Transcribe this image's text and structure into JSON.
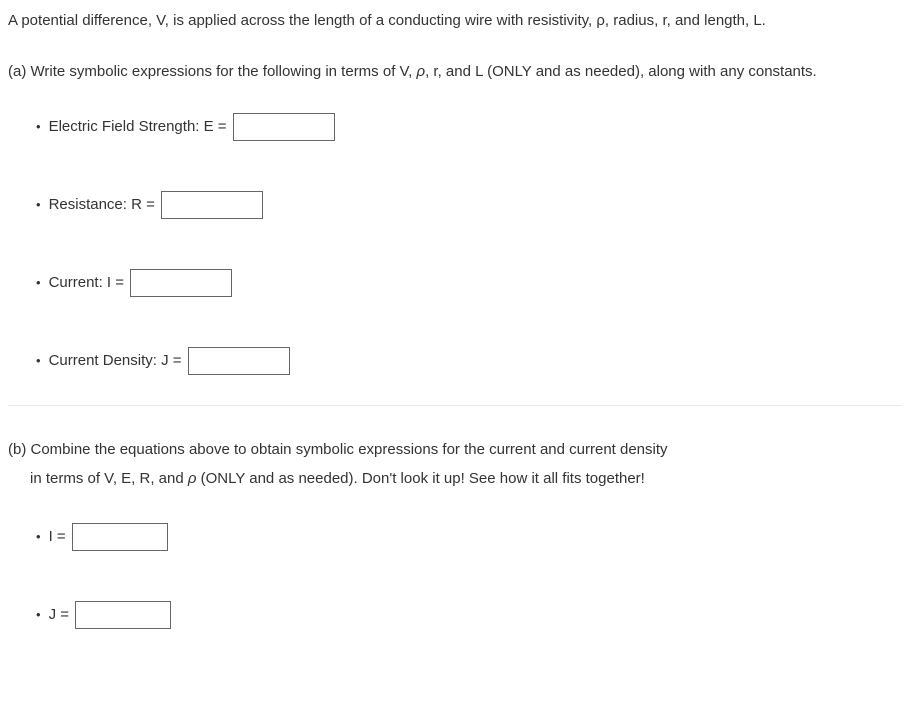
{
  "intro": "A potential difference, V, is applied across the length of a conducting wire with resistivity, ρ, radius, r, and length, L.",
  "partA": {
    "prompt_prefix": "(a) Write symbolic expressions for the following in terms of V, ",
    "prompt_rho": "ρ",
    "prompt_suffix": ", r, and L (ONLY and as needed), along with any constants.",
    "items": [
      {
        "label": "Electric Field Strength: E = "
      },
      {
        "label": "Resistance: R = "
      },
      {
        "label": "Current: I = "
      },
      {
        "label": "Current Density: J = "
      }
    ]
  },
  "partB": {
    "line1_prefix": "(b) Combine the equations above to obtain symbolic expressions for the current and current density",
    "line2_prefix": "in terms of V, E, R, and ",
    "line2_rho": "ρ",
    "line2_suffix": " (ONLY and as needed). Don't look it up! See how it all fits together!",
    "items": [
      {
        "label": "I = "
      },
      {
        "label": "J = "
      }
    ]
  }
}
